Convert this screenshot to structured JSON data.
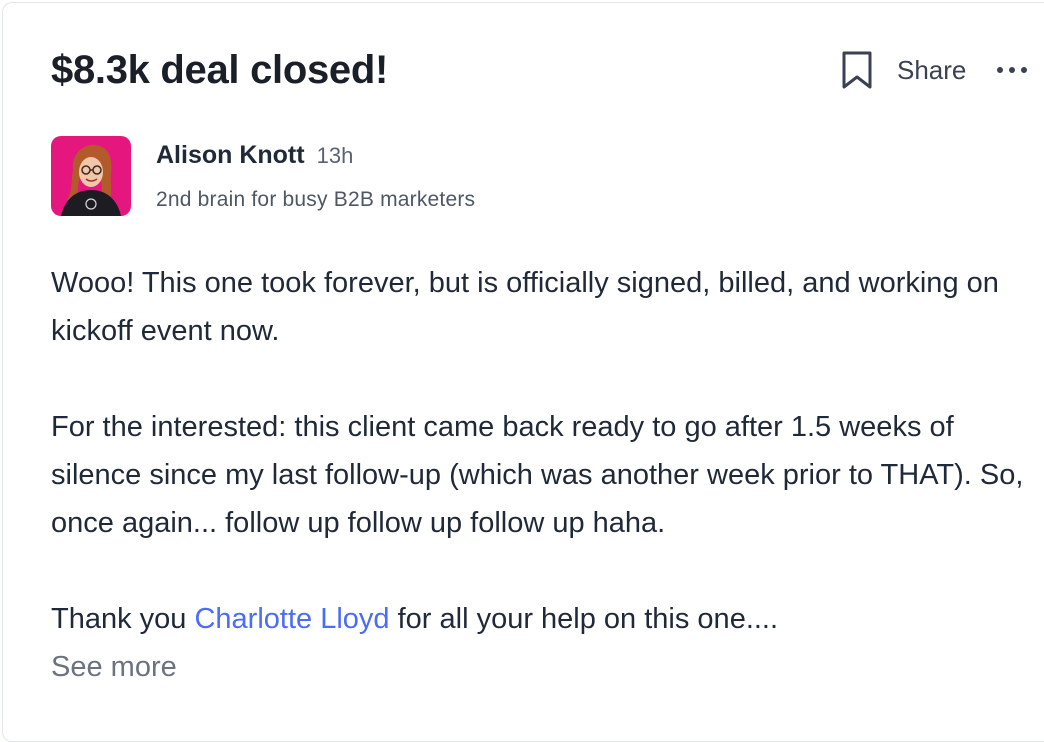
{
  "post": {
    "title": "$8.3k deal closed!",
    "actions": {
      "share_label": "Share"
    },
    "author": {
      "name": "Alison Knott",
      "time_ago": "13h",
      "tagline": "2nd brain for busy B2B marketers"
    },
    "body": {
      "paragraph_1": "Wooo! This one took forever, but is officially signed, billed, and working on kickoff event now.",
      "paragraph_2": "For the interested: this client came back ready to go after 1.5 weeks of silence since my last follow-up (which was another week prior to THAT). So, once again... follow up follow up follow up haha.",
      "paragraph_3_prefix": "Thank you ",
      "paragraph_3_mention": "Charlotte Lloyd",
      "paragraph_3_suffix": " for all your help on this one....",
      "see_more_label": "See more"
    }
  },
  "colors": {
    "mention": "#4a6cf7",
    "avatar_background": "#e5177f"
  },
  "icons": [
    "bookmark-icon",
    "more-options-icon"
  ]
}
